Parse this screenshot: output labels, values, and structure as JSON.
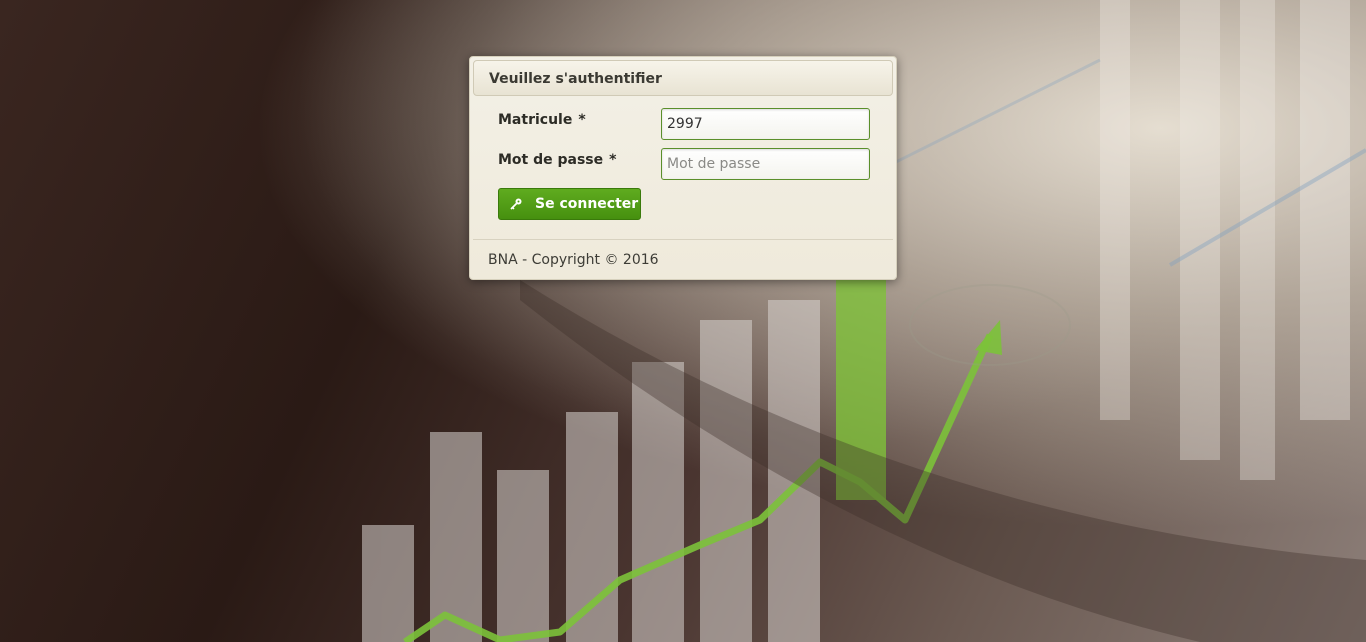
{
  "login": {
    "title": "Veuillez s'authentifier",
    "matricule_label": "Matricule",
    "matricule_value": "2997",
    "password_label": "Mot de passe",
    "password_placeholder": "Mot de passe",
    "required_mark": "*",
    "submit_label": "Se connecter",
    "submit_icon": "key-icon"
  },
  "footer": {
    "copyright": "BNA - Copyright © 2016"
  },
  "colors": {
    "accent_green": "#4c9a12",
    "panel_bg": "#f1eee2"
  }
}
